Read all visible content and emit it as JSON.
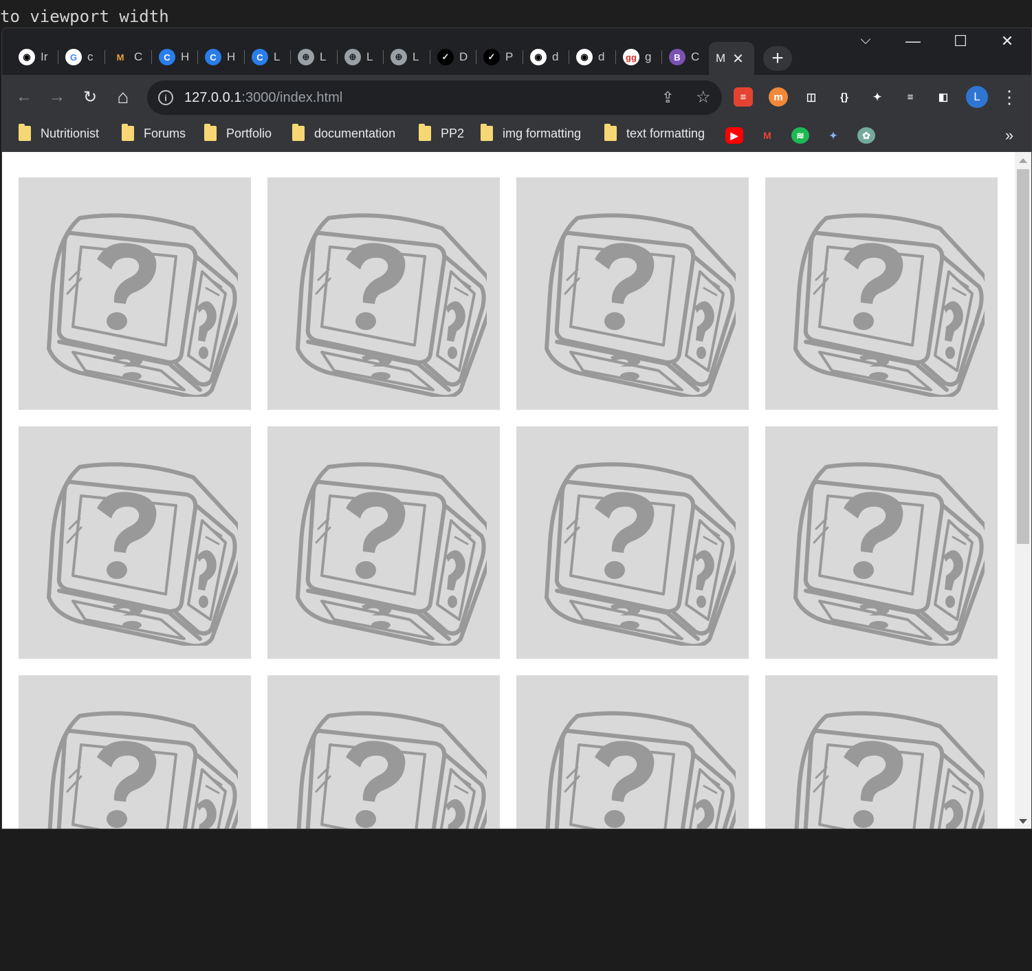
{
  "editor": {
    "text": "to viewport width"
  },
  "tabs": [
    {
      "label": "Ir",
      "icon": "github-icon",
      "bg": "#ffffff",
      "fg": "#000000",
      "glyph": "◉"
    },
    {
      "label": "c",
      "icon": "google-icon",
      "bg": "#ffffff",
      "fg": "#4285f4",
      "glyph": "G"
    },
    {
      "label": "C",
      "icon": "mdn-icon",
      "bg": "#202124",
      "fg": "#e8a33d",
      "glyph": "M"
    },
    {
      "label": "H",
      "icon": "codeinstitute-icon",
      "bg": "#2b7de9",
      "fg": "#ffffff",
      "glyph": "C"
    },
    {
      "label": "H",
      "icon": "codeinstitute-icon",
      "bg": "#2b7de9",
      "fg": "#ffffff",
      "glyph": "C"
    },
    {
      "label": "L",
      "icon": "codeinstitute-icon",
      "bg": "#2b7de9",
      "fg": "#ffffff",
      "glyph": "C"
    },
    {
      "label": "L",
      "icon": "globe-icon",
      "bg": "#9aa0a6",
      "fg": "#202124",
      "glyph": "⊕"
    },
    {
      "label": "L",
      "icon": "globe-icon",
      "bg": "#9aa0a6",
      "fg": "#202124",
      "glyph": "⊕"
    },
    {
      "label": "L",
      "icon": "globe-icon",
      "bg": "#9aa0a6",
      "fg": "#202124",
      "glyph": "⊕"
    },
    {
      "label": "D",
      "icon": "check-circle-icon",
      "bg": "#000000",
      "fg": "#e8eaed",
      "glyph": "✓"
    },
    {
      "label": "P",
      "icon": "check-circle-icon",
      "bg": "#000000",
      "fg": "#e8eaed",
      "glyph": "✓"
    },
    {
      "label": "d",
      "icon": "github-icon",
      "bg": "#ffffff",
      "fg": "#000000",
      "glyph": "◉"
    },
    {
      "label": "d",
      "icon": "github-icon",
      "bg": "#ffffff",
      "fg": "#000000",
      "glyph": "◉"
    },
    {
      "label": "g",
      "icon": "gg-icon",
      "bg": "#ffffff",
      "fg": "#d93025",
      "glyph": "gg"
    },
    {
      "label": "C",
      "icon": "bootstrap-icon",
      "bg": "#7952b3",
      "fg": "#ffffff",
      "glyph": "B"
    }
  ],
  "active_tab": {
    "label": "M",
    "close": "✕"
  },
  "newtab": "+",
  "window": {
    "dropdown": "⌵",
    "minimize": "—",
    "maximize": "☐",
    "close": "✕"
  },
  "toolbar": {
    "back": "←",
    "forward": "→",
    "reload": "↻",
    "home": "⌂",
    "url_host": "127.0.0.1",
    "url_rest": ":3000/index.html",
    "share": "⇪",
    "star": "☆"
  },
  "extensions": [
    {
      "icon": "todoist-icon",
      "bg": "#e44332",
      "glyph": "≡"
    },
    {
      "icon": "m-extension-icon",
      "bg": "#f0893a",
      "glyph": "m"
    },
    {
      "icon": "screen-capture-icon",
      "bg": "#35363a",
      "glyph": "◫"
    },
    {
      "icon": "json-icon",
      "bg": "#35363a",
      "glyph": "{}"
    },
    {
      "icon": "puzzle-icon",
      "bg": "#35363a",
      "glyph": "✦"
    },
    {
      "icon": "media-queue-icon",
      "bg": "#35363a",
      "glyph": "≡"
    },
    {
      "icon": "side-panel-icon",
      "bg": "#35363a",
      "glyph": "◧"
    }
  ],
  "profile": {
    "initial": "L"
  },
  "menu": "⋮",
  "bookmarks": [
    {
      "label": "Nutritionist"
    },
    {
      "label": "Forums"
    },
    {
      "label": "Portfolio"
    },
    {
      "label": "documentation"
    },
    {
      "label": "PP2"
    },
    {
      "label": "img formatting"
    },
    {
      "label": "text formatting"
    }
  ],
  "bookmark_icons": [
    {
      "icon": "youtube-icon",
      "bg": "#ff0000",
      "glyph": "▶"
    },
    {
      "icon": "gmail-icon",
      "bg": "#35363a",
      "glyph": "M"
    },
    {
      "icon": "spotify-icon",
      "bg": "#1db954",
      "glyph": "≋"
    },
    {
      "icon": "sparkle-icon",
      "bg": "#35363a",
      "glyph": "✦"
    },
    {
      "icon": "chatgpt-icon",
      "bg": "#74aa9c",
      "glyph": "✿"
    }
  ],
  "more_bookmarks": "»",
  "gallery": {
    "placeholder_count": 12,
    "placeholder_icon": "mystery-box-icon",
    "card_color": "#d9d9d9",
    "icon_color": "#999999"
  }
}
